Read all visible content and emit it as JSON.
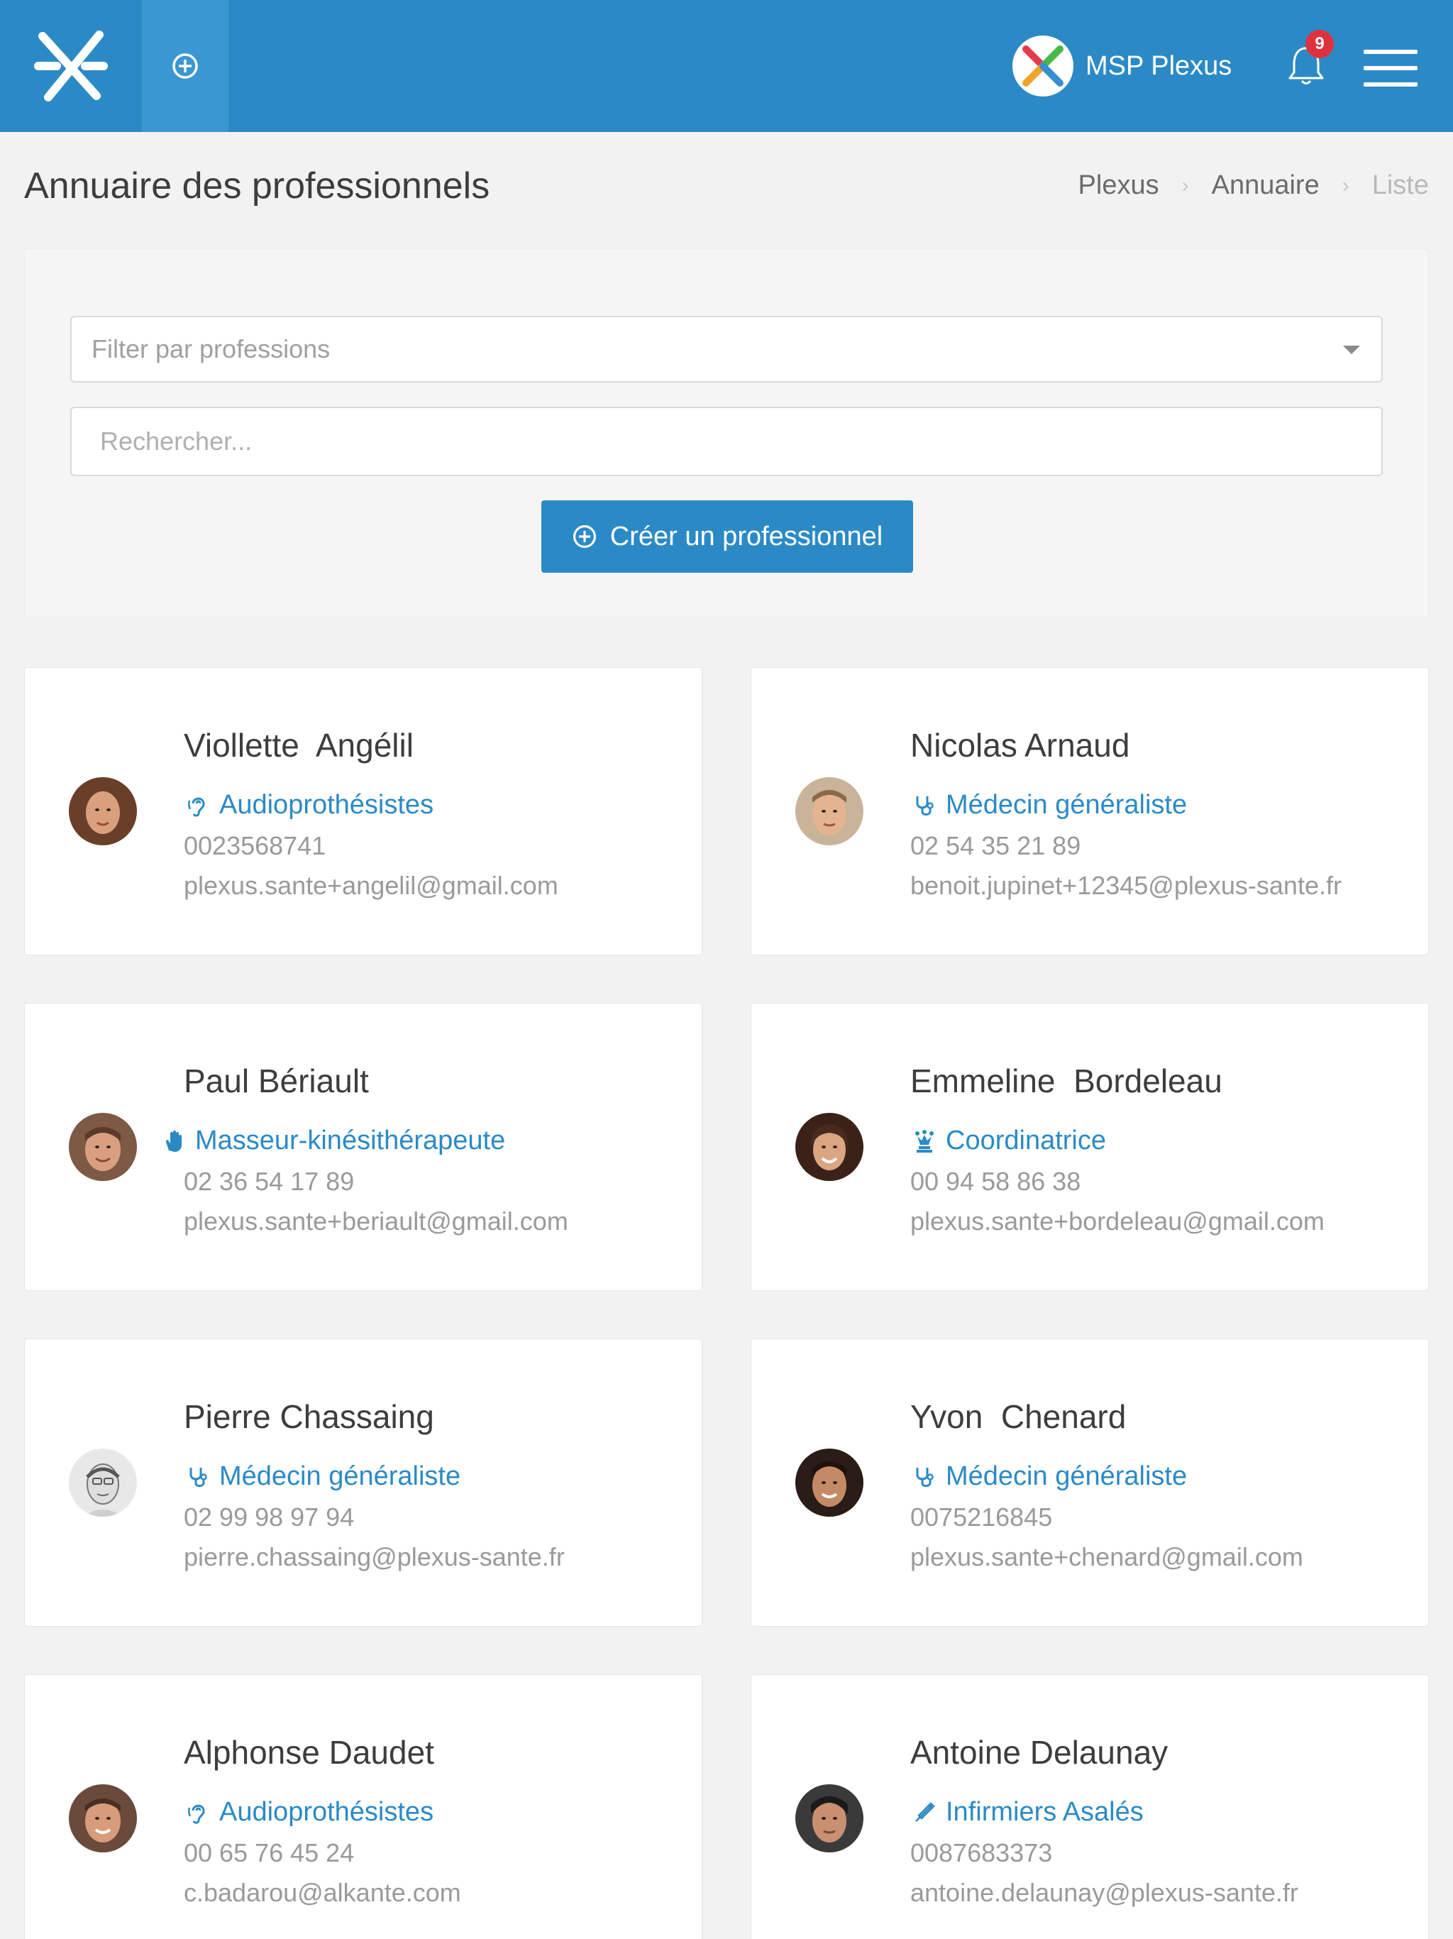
{
  "header": {
    "org_name": "MSP Plexus",
    "notifications_count": "9",
    "brand_color": "#2b8ac6"
  },
  "page": {
    "title": "Annuaire des professionnels",
    "breadcrumb": [
      "Plexus",
      "Annuaire",
      "Liste"
    ]
  },
  "filters": {
    "professions_placeholder": "Filter par professions",
    "search_placeholder": "Rechercher...",
    "create_button": "Créer un professionnel"
  },
  "professionals": [
    {
      "name": "Viollette  Angélil",
      "profession": "Audioprothésistes",
      "icon": "ear-icon",
      "phone": "0023568741",
      "email": "plexus.sante+angelil@gmail.com"
    },
    {
      "name": "Nicolas Arnaud",
      "profession": "Médecin généraliste",
      "icon": "stethoscope-icon",
      "phone": "02 54 35 21 89",
      "email": "benoit.jupinet+12345@plexus-sante.fr"
    },
    {
      "name": "Paul Bériault",
      "profession": "Masseur-kinésithérapeute",
      "icon": "hand-icon",
      "phone": "02 36 54 17 89",
      "email": "plexus.sante+beriault@gmail.com"
    },
    {
      "name": "Emmeline  Bordeleau",
      "profession": "Coordinatrice",
      "icon": "chess-queen-icon",
      "phone": "00 94 58 86 38",
      "email": "plexus.sante+bordeleau@gmail.com"
    },
    {
      "name": "Pierre Chassaing",
      "profession": "Médecin généraliste",
      "icon": "stethoscope-icon",
      "phone": "02 99 98 97 94",
      "email": "pierre.chassaing@plexus-sante.fr"
    },
    {
      "name": "Yvon  Chenard",
      "profession": "Médecin généraliste",
      "icon": "stethoscope-icon",
      "phone": "0075216845",
      "email": "plexus.sante+chenard@gmail.com"
    },
    {
      "name": "Alphonse Daudet",
      "profession": "Audioprothésistes",
      "icon": "ear-icon",
      "phone": "00 65 76 45 24",
      "email": "c.badarou@alkante.com"
    },
    {
      "name": "Antoine Delaunay",
      "profession": "Infirmiers Asalés",
      "icon": "syringe-icon",
      "phone": "0087683373",
      "email": "antoine.delaunay@plexus-sante.fr"
    }
  ]
}
